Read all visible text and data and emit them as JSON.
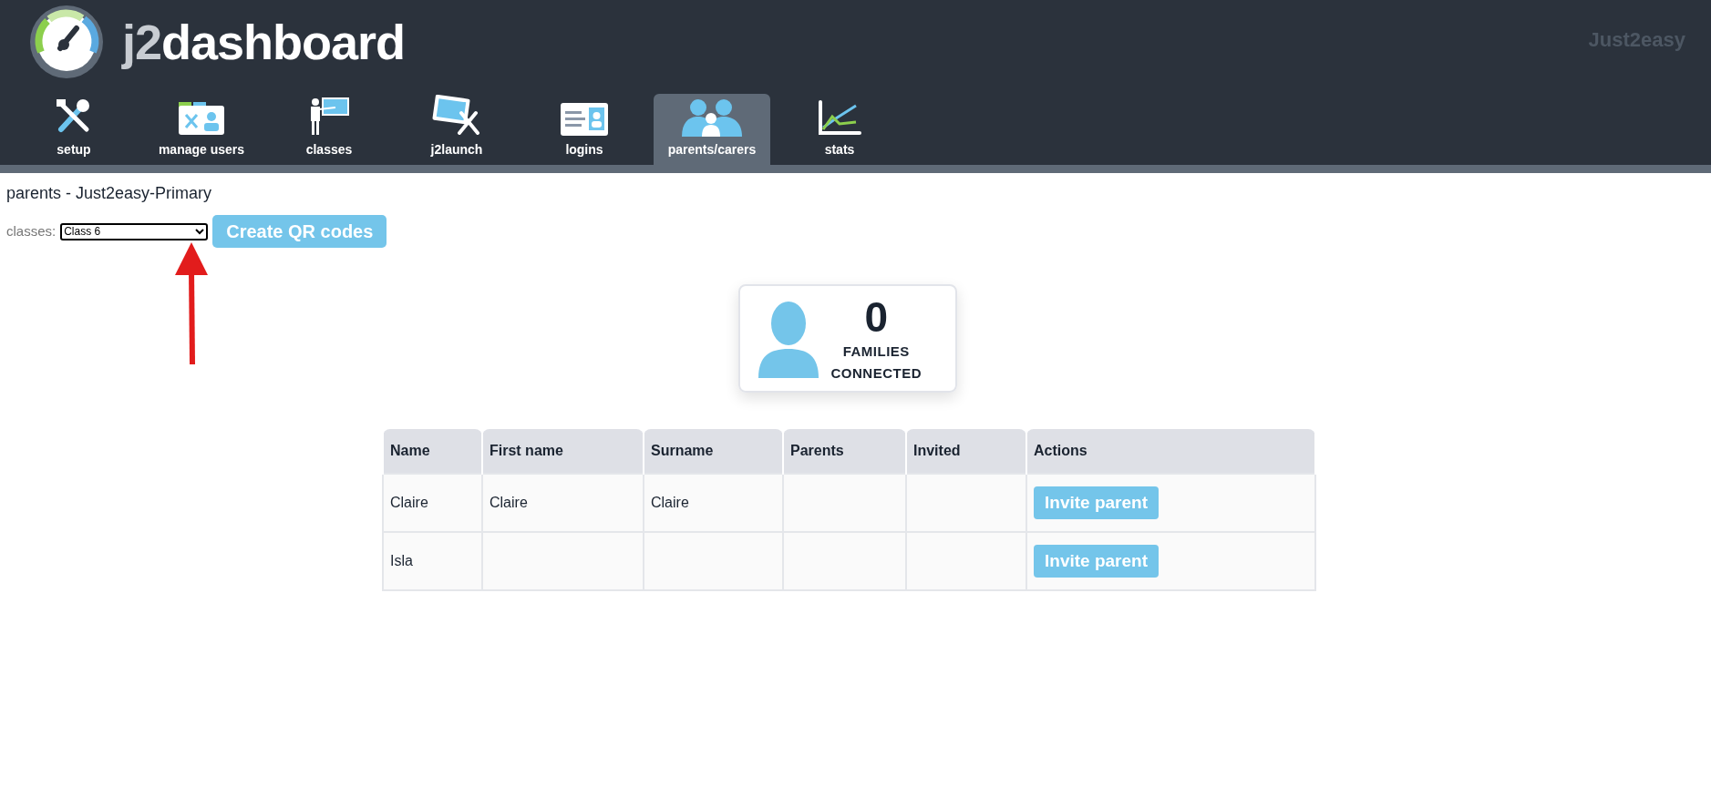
{
  "header": {
    "logo_text_prefix": "j2",
    "logo_text": "dashboard",
    "brand": "Just2easy"
  },
  "tabs": [
    {
      "label": "setup",
      "selected": false
    },
    {
      "label": "manage users",
      "selected": false
    },
    {
      "label": "classes",
      "selected": false
    },
    {
      "label": "j2launch",
      "selected": false
    },
    {
      "label": "logins",
      "selected": false
    },
    {
      "label": "parents/carers",
      "selected": true
    },
    {
      "label": "stats",
      "selected": false
    }
  ],
  "page_title": "parents - Just2easy-Primary",
  "class_filter": {
    "label": "classes:",
    "value": "Class 6"
  },
  "qr_button": "Create QR codes",
  "stat_card": {
    "value": "0",
    "label_line_1": "FAMILIES",
    "label_line_2": "CONNECTED"
  },
  "table": {
    "columns": [
      "Name",
      "First name",
      "Surname",
      "Parents",
      "Invited",
      "Actions"
    ],
    "rows": [
      {
        "cells": [
          "Claire",
          "Claire",
          "Claire",
          "",
          ""
        ],
        "action": "Invite parent"
      },
      {
        "cells": [
          "Isla",
          "",
          "",
          "",
          ""
        ],
        "action": "Invite parent"
      }
    ]
  }
}
